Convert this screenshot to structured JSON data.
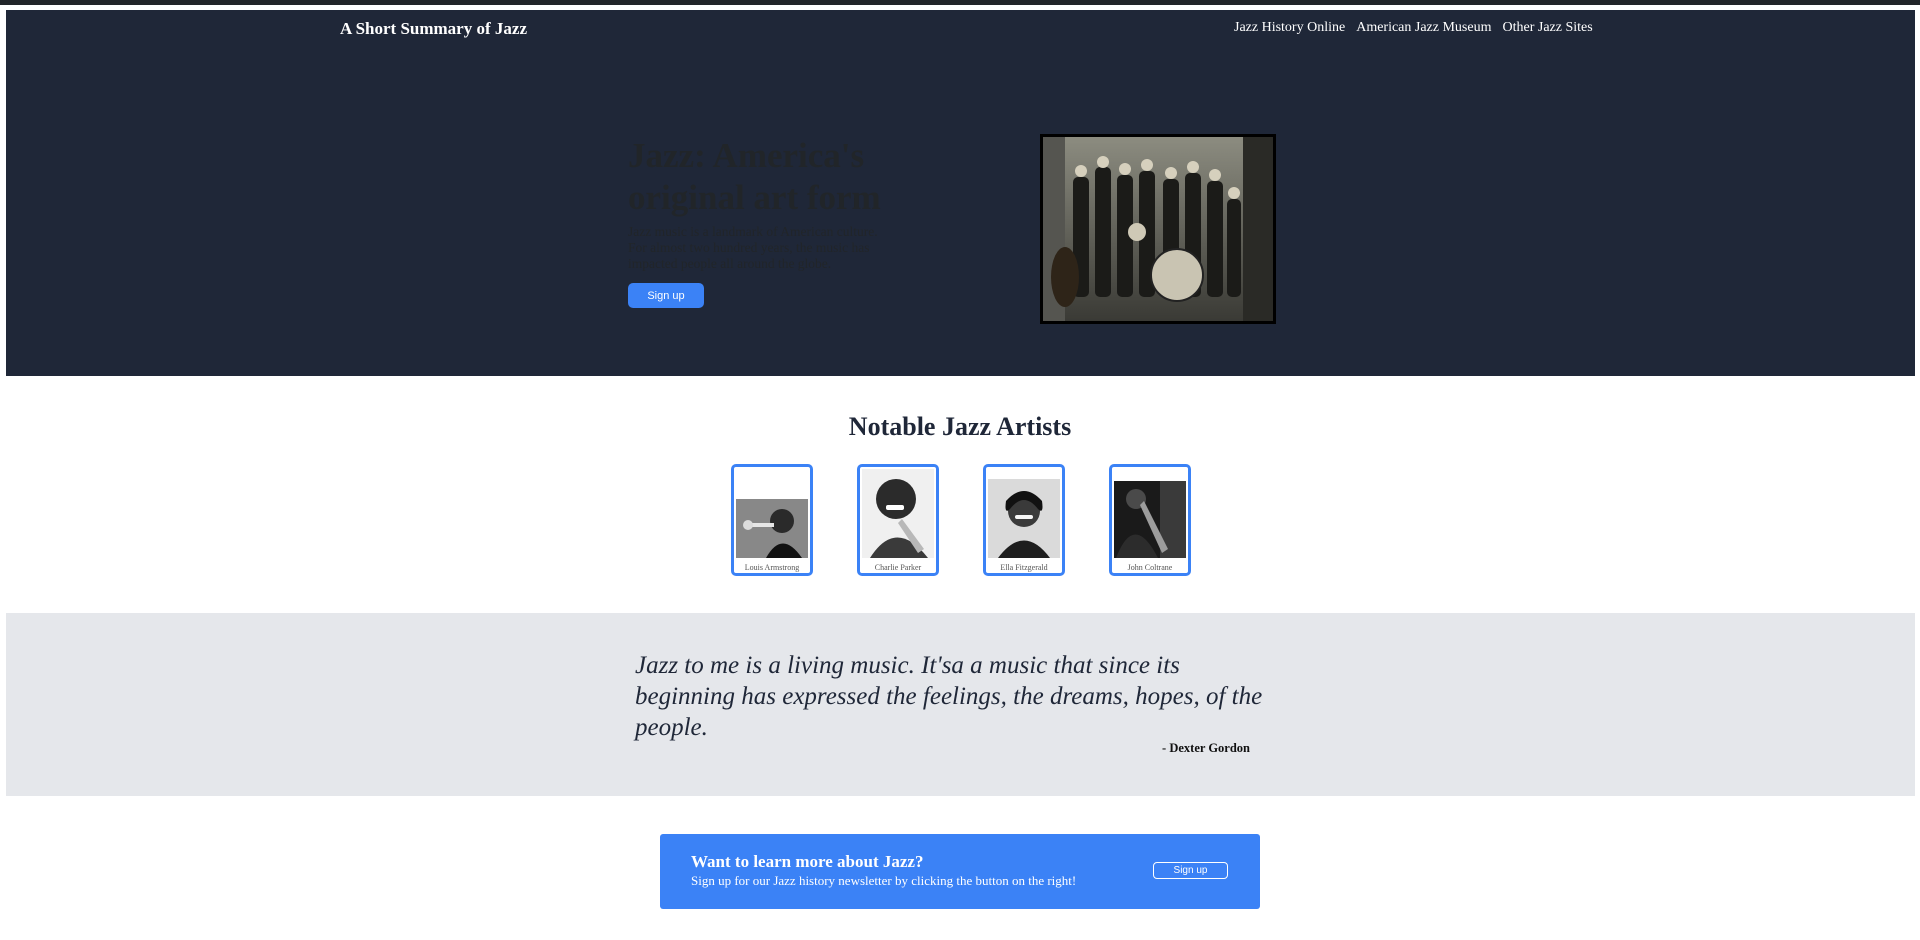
{
  "header": {
    "brand": "A Short Summary of Jazz",
    "nav": [
      "Jazz History Online",
      "American Jazz Museum",
      "Other Jazz Sites"
    ]
  },
  "hero": {
    "title": "Jazz: America's original art form",
    "text": "Jazz music is a landmark of American culture. For almost two hundred years, the music has impacted people all around the globe.",
    "button": "Sign up"
  },
  "artists": {
    "title": "Notable Jazz Artists",
    "cards": [
      "Louis Armstrong",
      "Charlie Parker",
      "Ella Fitzgerald",
      "John Coltrane"
    ]
  },
  "quote": {
    "text": "Jazz to me is a living music. It'sa a music that since its beginning has expressed the feelings, the dreams, hopes, of the people.",
    "author": "- Dexter Gordon"
  },
  "cta": {
    "title": "Want to learn more about Jazz?",
    "text": "Sign up for our Jazz history newsletter by clicking the button on the right!",
    "button": "Sign up"
  },
  "colors": {
    "hero_bg": "#1f2738",
    "accent": "#3b82f6",
    "quote_bg": "#e5e7eb"
  }
}
